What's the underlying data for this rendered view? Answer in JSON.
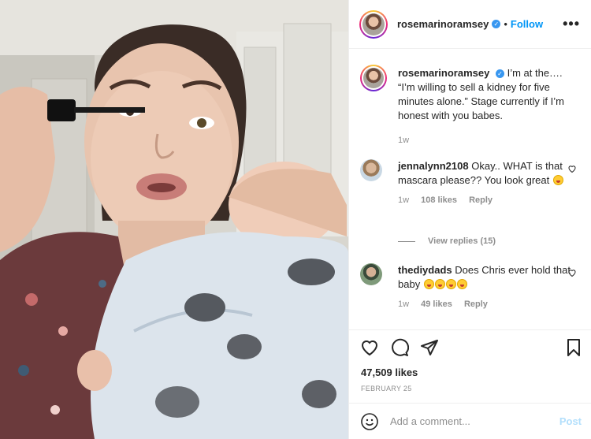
{
  "post": {
    "username": "rosemarinoramsey",
    "follow_label": "Follow",
    "dot": "•",
    "more_label": "•••",
    "verified_mark": "✓"
  },
  "caption": {
    "username": "rosemarinoramsey",
    "text": "I’m at the…. “I’m willing to sell a kidney for five minutes alone.” Stage currently if I’m honest with you babes.",
    "time": "1w"
  },
  "comments": [
    {
      "username": "jennalynn2108",
      "text": "Okay.. WHAT is that mascara please?? You look great",
      "emoji_count": 1,
      "time": "1w",
      "likes": "108 likes",
      "reply": "Reply"
    },
    {
      "username": "thediydads",
      "text": "Does Chris ever hold that baby",
      "emoji_count": 4,
      "time": "1w",
      "likes": "49 likes",
      "reply": "Reply"
    }
  ],
  "view_replies": "View replies (15)",
  "stats": {
    "likes": "47,509 likes",
    "date": "FEBRUARY 25"
  },
  "add_comment": {
    "placeholder": "Add a comment...",
    "post_label": "Post"
  },
  "icons": {
    "like": "heart-icon",
    "comment": "comment-icon",
    "share": "paper-plane-icon",
    "save": "bookmark-icon",
    "emoji": "smiley-icon",
    "more": "more-options-icon"
  },
  "colors": {
    "accent": "#0095f6",
    "post_disabled": "#b2dffc",
    "muted": "#8e8e8e",
    "text": "#262626"
  }
}
